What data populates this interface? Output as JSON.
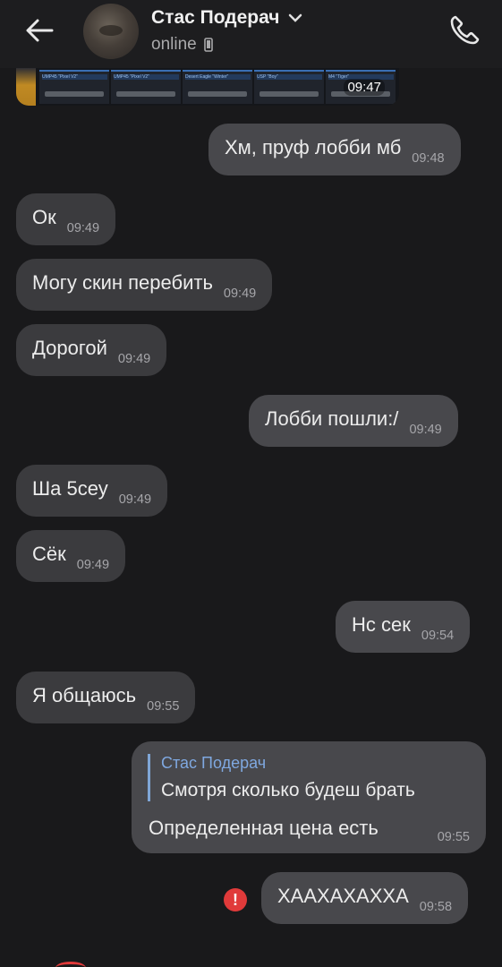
{
  "header": {
    "title": "Стас Подерач",
    "status": "online",
    "icons": {
      "back": "arrow-left-icon",
      "expand": "chevron-down-icon",
      "device": "phone-device-icon",
      "call": "phone-call-icon"
    }
  },
  "image_message": {
    "time": "09:47",
    "card_labels": [
      "UMP45 \"Pixel V2\"",
      "UMP45 \"Pixel V2\"",
      "Desert Eagle \"Winter\"",
      "USP \"Boy\"",
      "M4 \"Tiger\""
    ]
  },
  "messages": [
    {
      "side": "out",
      "text": "Хм, пруф лобби мб",
      "time": "09:48"
    },
    {
      "side": "in",
      "text": "Ок",
      "time": "09:49"
    },
    {
      "side": "in",
      "text": "Могу скин перебить",
      "time": "09:49"
    },
    {
      "side": "in",
      "text": "Дорогой",
      "time": "09:49"
    },
    {
      "side": "out",
      "text": "Лобби пошли:/",
      "time": "09:49"
    },
    {
      "side": "in",
      "text": "Ша 5сеу",
      "time": "09:49"
    },
    {
      "side": "in",
      "text": "Сёк",
      "time": "09:49"
    },
    {
      "side": "out",
      "text": "Нс сек",
      "time": "09:54"
    },
    {
      "side": "in",
      "text": "Я общаюсь",
      "time": "09:55"
    }
  ],
  "reply_message": {
    "quote_author": "Стас Подерач",
    "quote_text": "Смотря сколько будеш брать",
    "text": "Определенная цена есть",
    "time": "09:55"
  },
  "last_message": {
    "text": "ХААХАХАХХА",
    "time": "09:58",
    "error_mark": "!"
  },
  "colors": {
    "background": "#19191b",
    "incoming_bubble": "#3b3b3e",
    "outgoing_bubble": "#48484c",
    "quote_accent": "#7fa8e0",
    "error": "#e03a3a"
  }
}
